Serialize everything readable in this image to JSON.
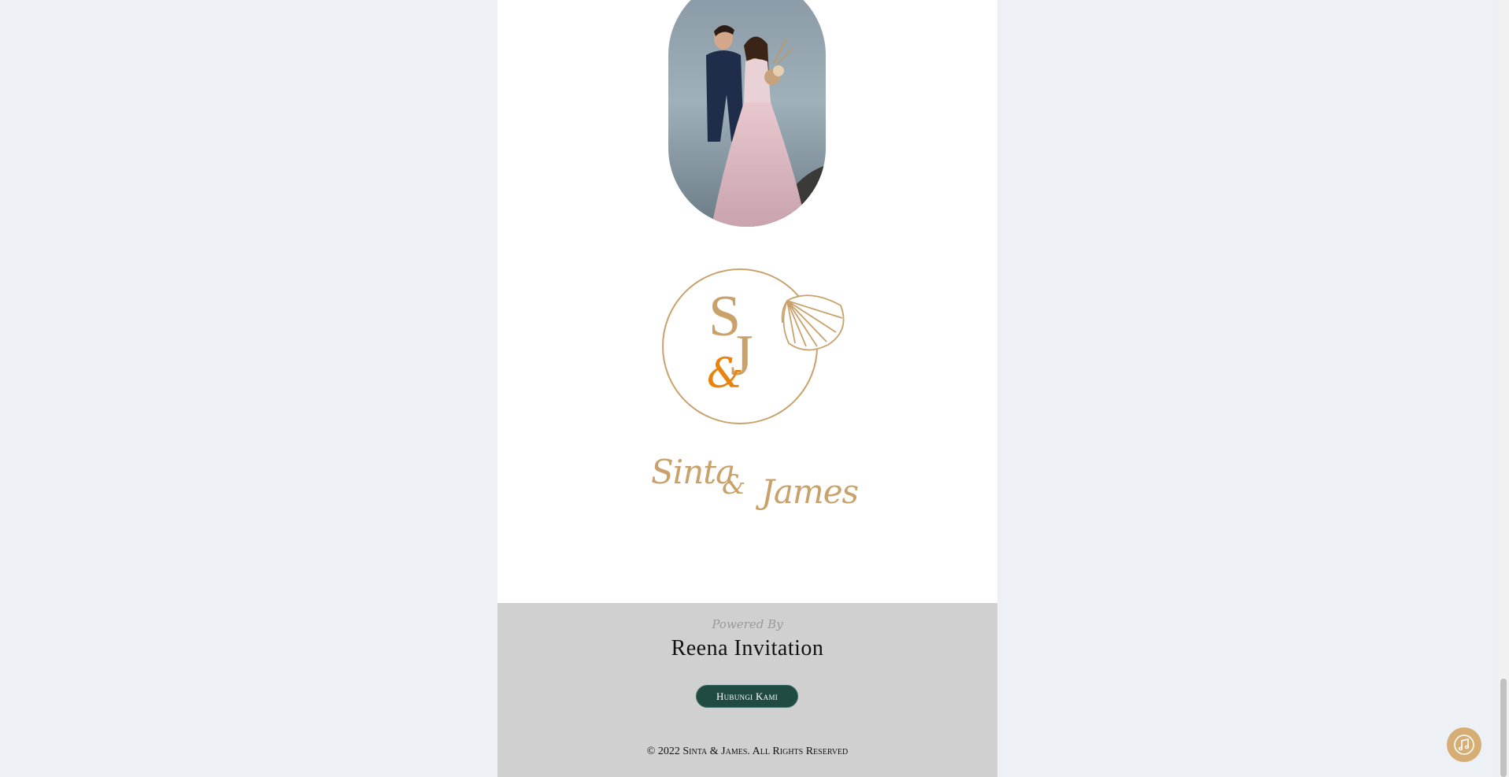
{
  "couple": {
    "photo_alt": "",
    "monogram": {
      "letter1": "S",
      "ampersand": "&",
      "letter2": "J"
    },
    "name1": "Sinta",
    "ampersand": "&",
    "name2": "James"
  },
  "footer": {
    "powered_by": "Powered By",
    "brand": "Reena Invitation",
    "contact_button": "Hubungi Kami",
    "copyright": "© 2022 Sinta & James. All Rights Reserved"
  },
  "controls": {
    "music_icon": "music-note-icon"
  },
  "colors": {
    "page_bg": "#edf1f6",
    "gold": "#c9a26b",
    "orange_amp": "#e8830e",
    "footer_bg": "#d0d0d0",
    "button_bg": "#1f4b43",
    "music_button": "#d6ad74"
  }
}
